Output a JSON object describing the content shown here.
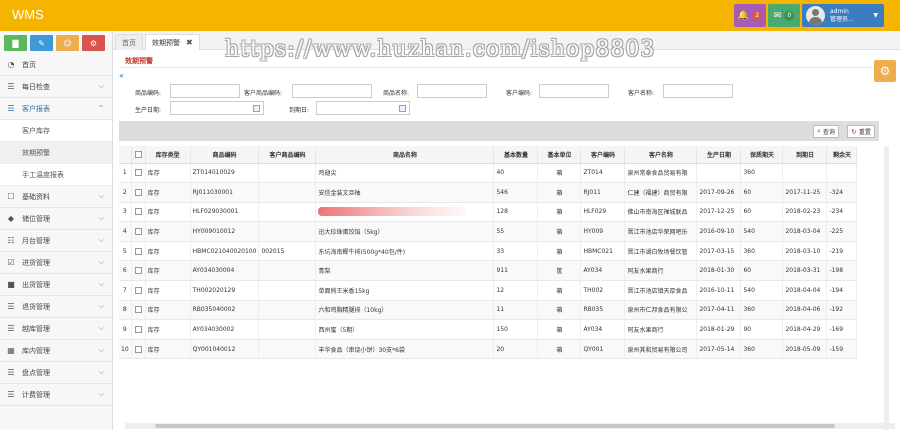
{
  "app": {
    "title": "WMS"
  },
  "header": {
    "bell_count": "2",
    "mail_count": "0",
    "user_name": "admin",
    "user_role": "管理员..."
  },
  "sidebar": {
    "items": [
      {
        "label": "首页",
        "icon": "dashboard-icon",
        "expandable": false
      },
      {
        "label": "每日检查",
        "icon": "list-icon",
        "expandable": true
      },
      {
        "label": "客户报表",
        "icon": "list-icon",
        "expandable": true,
        "active": true
      },
      {
        "label": "基础资料",
        "icon": "document-icon",
        "expandable": true
      },
      {
        "label": "储位管理",
        "icon": "tags-icon",
        "expandable": true
      },
      {
        "label": "月台管理",
        "icon": "grid-icon",
        "expandable": true
      },
      {
        "label": "进货管理",
        "icon": "checkbox-icon",
        "expandable": true
      },
      {
        "label": "出货管理",
        "icon": "truck-icon",
        "expandable": true
      },
      {
        "label": "退货管理",
        "icon": "list-icon",
        "expandable": true
      },
      {
        "label": "越库管理",
        "icon": "list-icon",
        "expandable": true
      },
      {
        "label": "库内管理",
        "icon": "film-icon",
        "expandable": true
      },
      {
        "label": "盘点管理",
        "icon": "list-icon",
        "expandable": true
      },
      {
        "label": "计费管理",
        "icon": "list-icon",
        "expandable": true
      }
    ],
    "sub_items": [
      "客户库存",
      "效期预警",
      "手工温度报表"
    ]
  },
  "tabs": {
    "home": "首页",
    "current": "效期预警"
  },
  "page": {
    "subtitle": "效期预警"
  },
  "filters": {
    "product_code": "商品编码:",
    "customer_product_code": "客户商品编码:",
    "product_name": "商品名称:",
    "customer_code": "客户编码:",
    "customer_name": "客户名称:",
    "production_date": "生产日期:",
    "expiry_date": "到期日:"
  },
  "toolbar": {
    "query": "查询",
    "reset": "重置"
  },
  "table": {
    "headers": [
      "",
      "",
      "库存类型",
      "商品编码",
      "客户商品编码",
      "商品名称",
      "基本数量",
      "基本单位",
      "客户编码",
      "客户名称",
      "生产日期",
      "保质期天",
      "到期日",
      "剩余天"
    ],
    "rows": [
      [
        "1",
        "库存",
        "ZT014010029",
        "",
        "鸡翅尖",
        "40",
        "箱",
        "ZT014",
        "泉州常泰食品贸易有限",
        "",
        "360",
        "",
        ""
      ],
      [
        "2",
        "库存",
        "RJ011030001",
        "",
        "安信金装文旦柚",
        "546",
        "箱",
        "RJ011",
        "仁建（福建）商贸有限",
        "2017-09-26",
        "60",
        "2017-11-25",
        "-324"
      ],
      [
        "3",
        "库存",
        "HLF029030001",
        "",
        "",
        "128",
        "箱",
        "HLF029",
        "佛山市南海区禅城联品",
        "2017-12-25",
        "60",
        "2018-02-23",
        "-234"
      ],
      [
        "4",
        "库存",
        "HY009010012",
        "",
        "迅大珍珠蛋饺馅（5kg）",
        "55",
        "箱",
        "HY009",
        "晋江市池店华荣网吧乐",
        "2016-09-10",
        "540",
        "2018-03-04",
        "-225"
      ],
      [
        "5",
        "库存",
        "HBMC021040020100",
        "002015",
        "东坑海南椰牛排(500g*40包/件)",
        "33",
        "箱",
        "HBMC021",
        "晋江市湖白牧场餐饮管",
        "2017-03-15",
        "360",
        "2018-03-10",
        "-219"
      ],
      [
        "6",
        "库存",
        "AY034030004",
        "",
        "青梨",
        "911",
        "筐",
        "AY034",
        "阿友水果商行",
        "2018-01-30",
        "60",
        "2018-03-31",
        "-198"
      ],
      [
        "7",
        "库存",
        "TH002020129",
        "",
        "单面煎王米香15kg",
        "12",
        "箱",
        "TH002",
        "晋江市池店镇天厚食品",
        "2016-10-11",
        "540",
        "2018-04-04",
        "-194"
      ],
      [
        "8",
        "库存",
        "RB035040002",
        "",
        "六和鸡胸精腿排（10kg）",
        "11",
        "箱",
        "RB035",
        "泉州市仁邦食品有限公",
        "2017-04-11",
        "360",
        "2018-04-06",
        "-192"
      ],
      [
        "9",
        "库存",
        "AY034030002",
        "",
        "西州蜜（5期）",
        "150",
        "箱",
        "AY034",
        "阿友水果商行",
        "2018-01-29",
        "90",
        "2018-04-29",
        "-169"
      ],
      [
        "10",
        "库存",
        "QY001040012",
        "",
        "丰华食品（串烧小饼）30支*6袋",
        "20",
        "箱",
        "QY001",
        "泉州其和贸易有限公司",
        "2017-05-14",
        "360",
        "2018-05-09",
        "-159"
      ]
    ]
  },
  "watermark": "https://www.huzhan.com/ishop8803"
}
